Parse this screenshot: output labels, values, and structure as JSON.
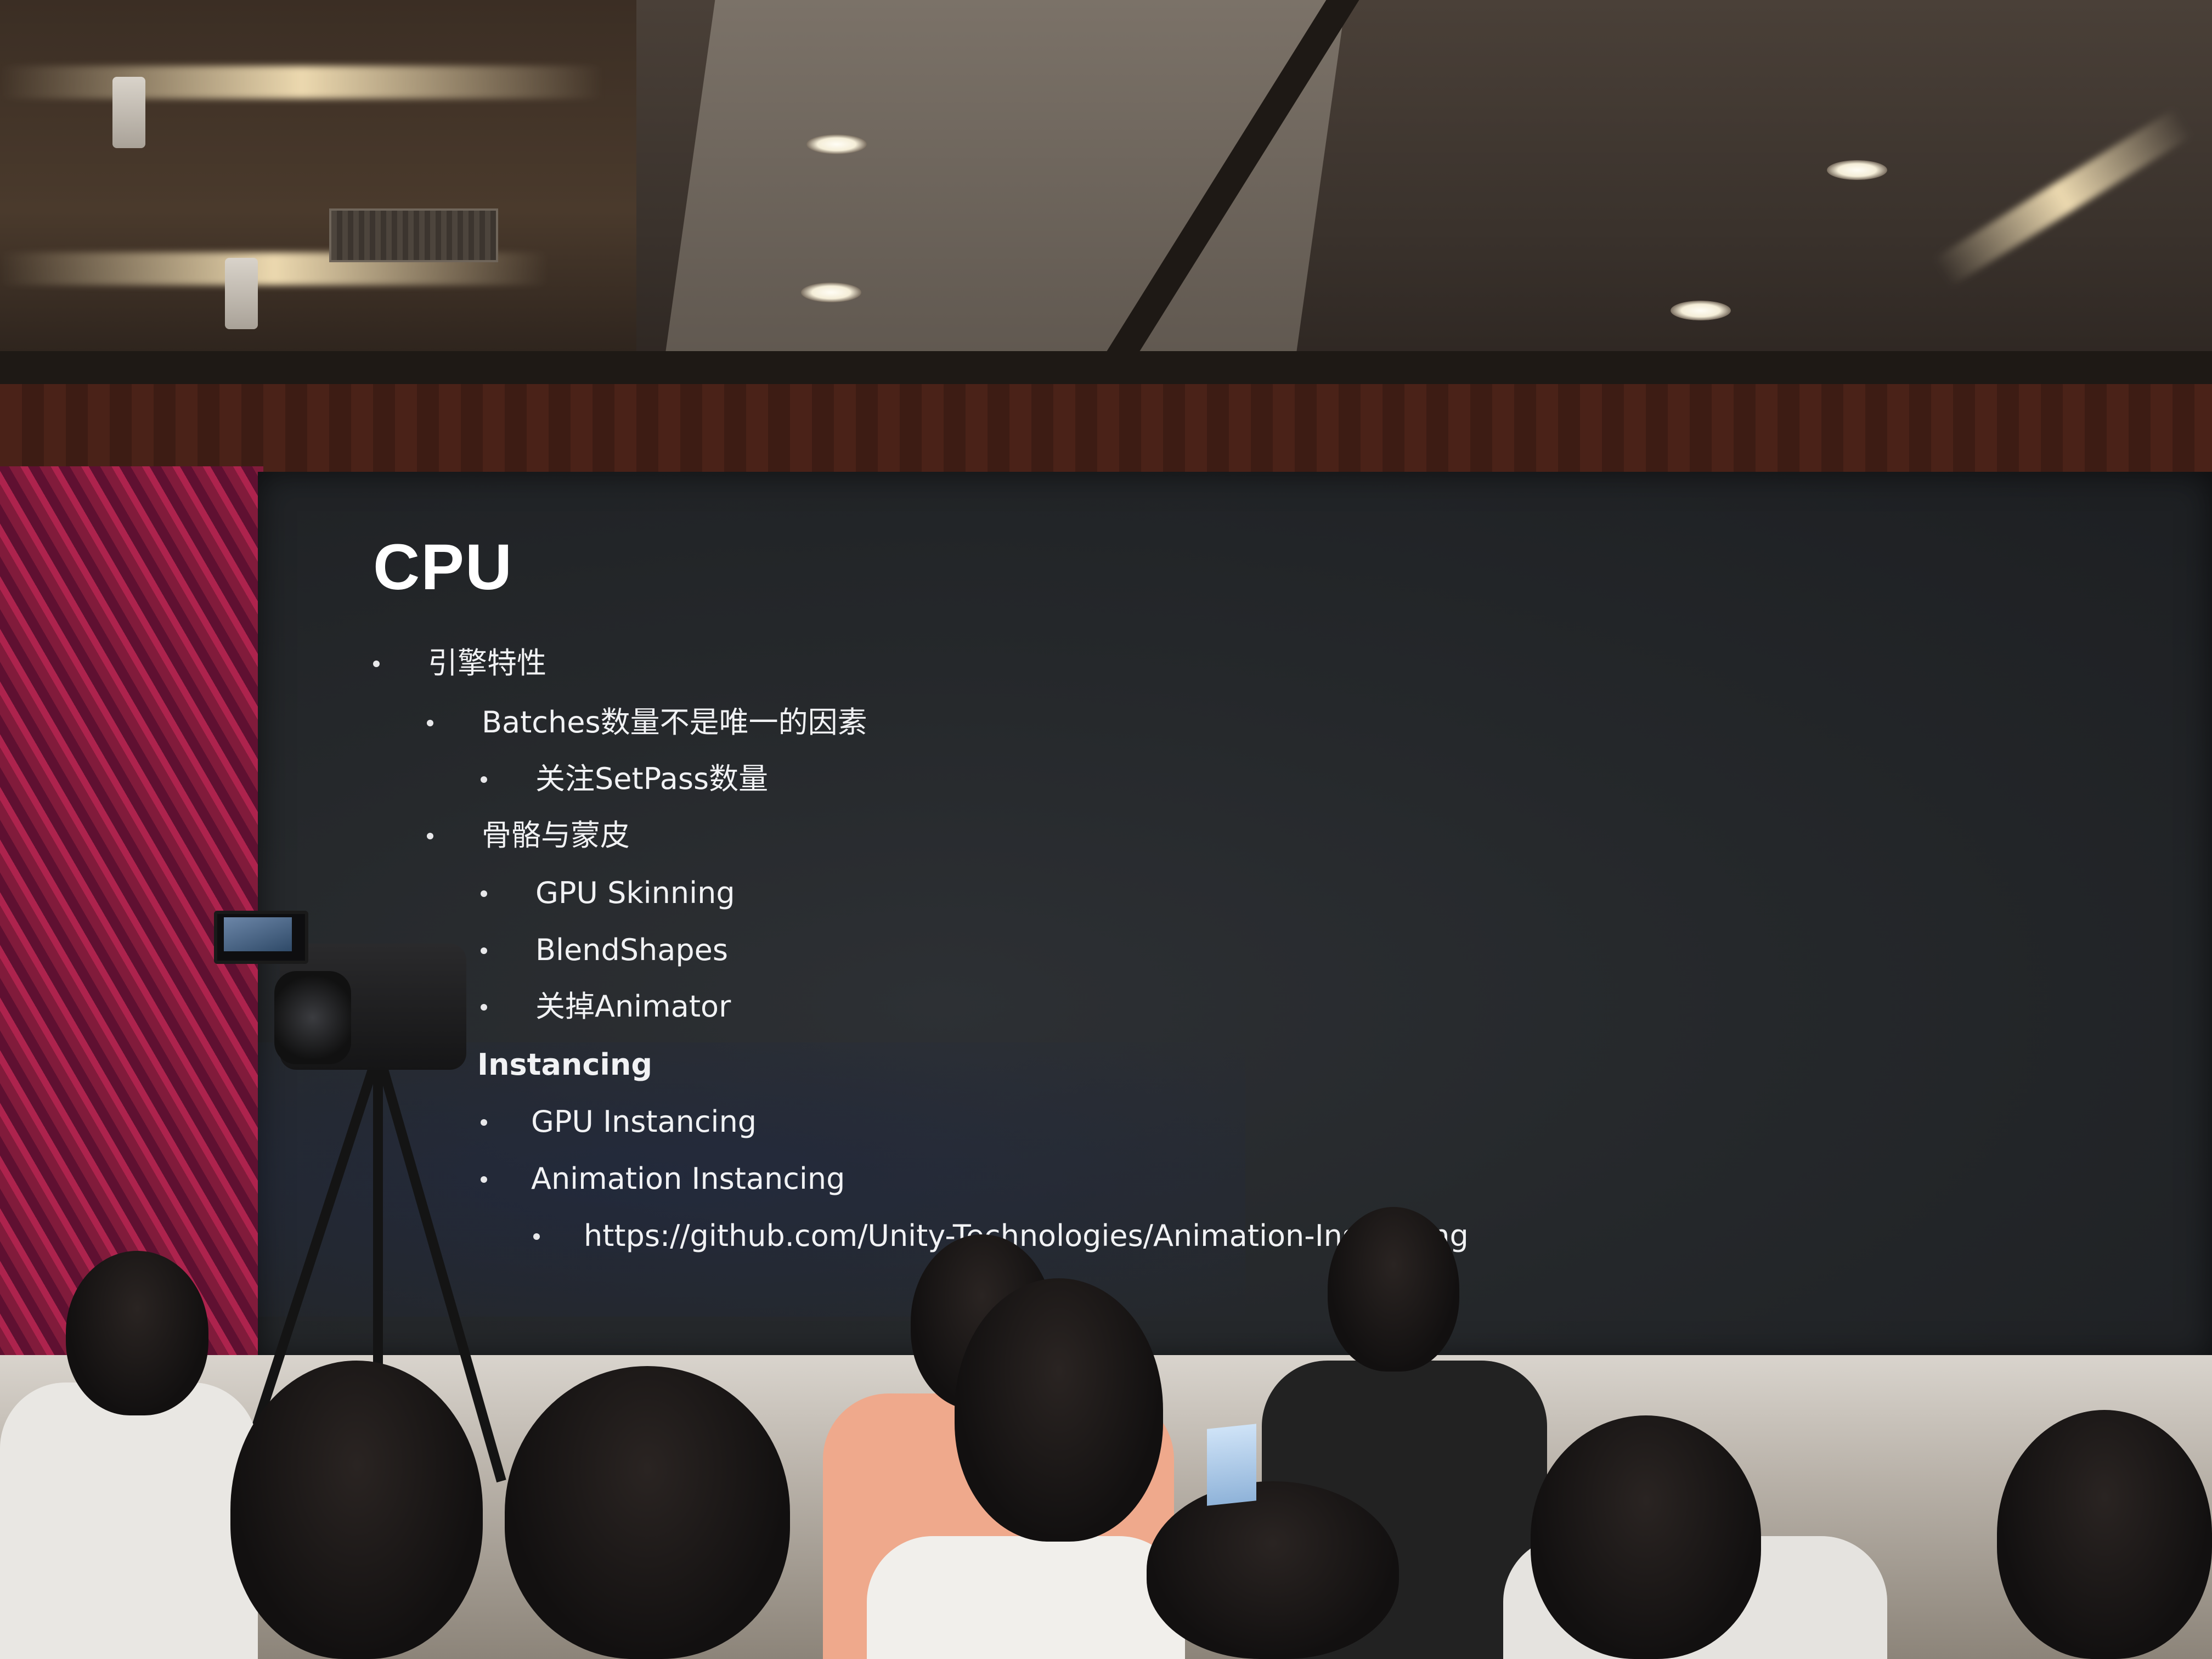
{
  "slide": {
    "title": "CPU",
    "items": [
      {
        "text": "引擎特性"
      },
      {
        "text": "Batches数量不是唯一的因素"
      },
      {
        "text": "关注SetPass数量"
      },
      {
        "text": "骨骼与蒙皮"
      },
      {
        "text": "GPU Skinning"
      },
      {
        "text": "BlendShapes"
      },
      {
        "text": "关掉Animator"
      },
      {
        "text": "Instancing"
      },
      {
        "text": "GPU Instancing"
      },
      {
        "text": "Animation Instancing"
      },
      {
        "text": "https://github.com/Unity-Technologies/Animation-Instancing"
      }
    ]
  },
  "colors": {
    "screen_background": "#25282b",
    "slide_text": "#f1f2f4",
    "side_panel_accent": "#a3264c"
  }
}
